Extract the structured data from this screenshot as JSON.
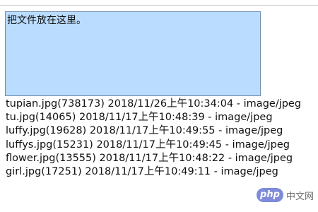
{
  "drop_zone": {
    "label": "把文件放在这里。"
  },
  "files": [
    "tupian.jpg(738173) 2018/11/26上午10:34:04 - image/jpeg",
    "tu.jpg(14065) 2018/11/17上午10:48:39 - image/jpeg",
    "luffy.jpg(19628) 2018/11/17上午10:49:55 - image/jpeg",
    "luffys.jpg(15231) 2018/11/17上午10:49:45 - image/jpeg",
    "flower.jpg(13555) 2018/11/17上午10:48:22 - image/jpeg",
    "girl.jpg(17251) 2018/11/17上午10:49:11 - image/jpeg"
  ],
  "watermark": {
    "badge": "php",
    "text": "中文网"
  },
  "colors": {
    "drop_zone_fill": "#b9dcff",
    "drop_zone_border": "#6f8fb3",
    "watermark_badge": "#6f7fd6"
  }
}
